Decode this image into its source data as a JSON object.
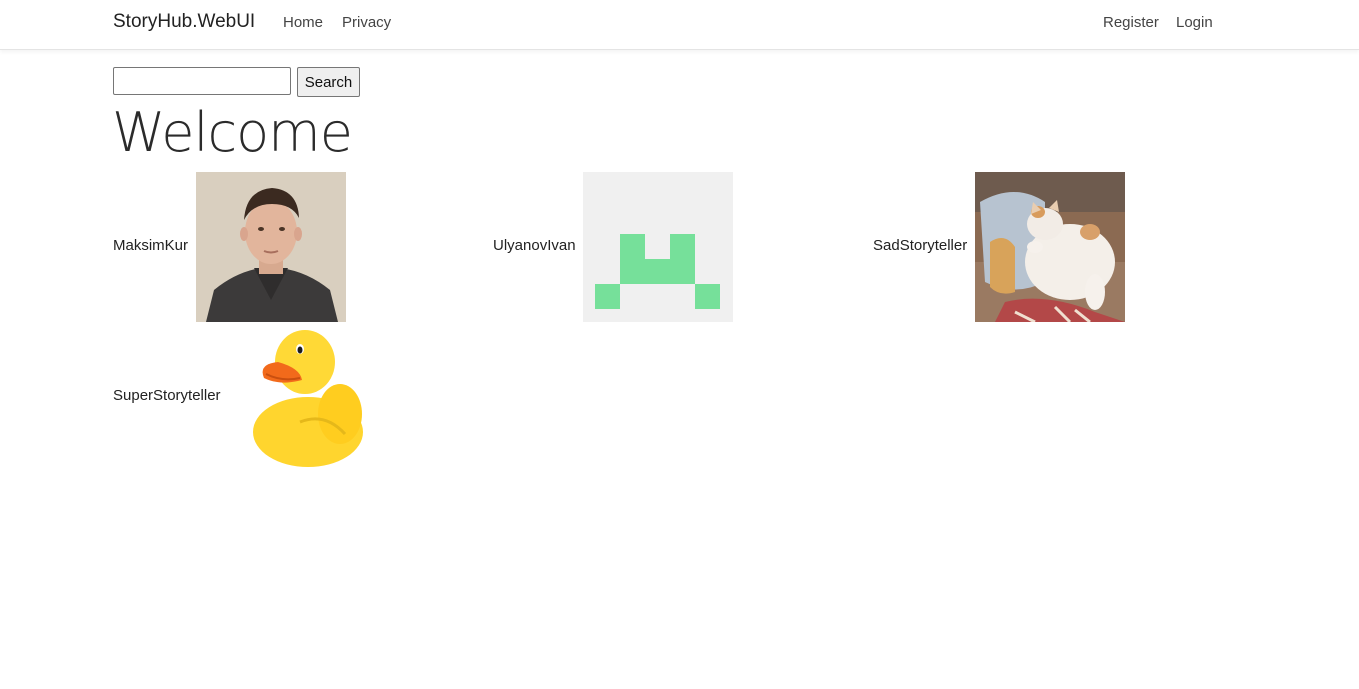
{
  "navbar": {
    "brand": "StoryHub.WebUI",
    "links": [
      "Home",
      "Privacy"
    ],
    "auth_links": [
      "Register",
      "Login"
    ]
  },
  "search": {
    "value": "",
    "placeholder": "",
    "button_label": "Search"
  },
  "page": {
    "title": "Welcome"
  },
  "users": [
    {
      "name": "MaksimKur",
      "avatar": "photo-of-young-man"
    },
    {
      "name": "UlyanovIvan",
      "avatar": "green-pixel-identicon"
    },
    {
      "name": "SadStoryteller",
      "avatar": "photo-of-fat-cat"
    },
    {
      "name": "SuperStoryteller",
      "avatar": "rubber-duck"
    }
  ],
  "colors": {
    "identicon_bg": "#f0f0f0",
    "identicon_fg": "#76e09a",
    "duck_yellow": "#ffd52e",
    "duck_beak": "#f26a1b"
  }
}
